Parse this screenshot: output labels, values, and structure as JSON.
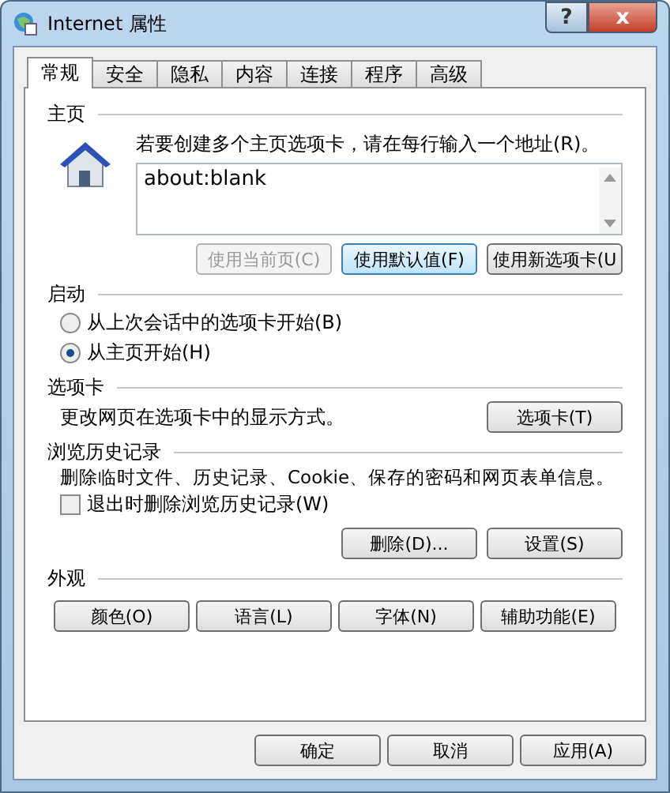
{
  "window": {
    "title": "Internet 属性",
    "help_button": "?",
    "close_button": "x"
  },
  "tabs": [
    {
      "label": "常规",
      "selected": true
    },
    {
      "label": "安全",
      "selected": false
    },
    {
      "label": "隐私",
      "selected": false
    },
    {
      "label": "内容",
      "selected": false
    },
    {
      "label": "连接",
      "selected": false
    },
    {
      "label": "程序",
      "selected": false
    },
    {
      "label": "高级",
      "selected": false
    }
  ],
  "home_page": {
    "heading": "主页",
    "instruction": "若要创建多个主页选项卡，请在每行输入一个地址(R)。",
    "value": "about:blank",
    "buttons": [
      {
        "label": "使用当前页(C)",
        "disabled": true,
        "focused": false
      },
      {
        "label": "使用默认值(F)",
        "disabled": false,
        "focused": true
      },
      {
        "label": "使用新选项卡(U",
        "disabled": false,
        "focused": false
      }
    ]
  },
  "startup": {
    "heading": "启动",
    "options": [
      {
        "label": "从上次会话中的选项卡开始(B)",
        "selected": false
      },
      {
        "label": "从主页开始(H)",
        "selected": true
      }
    ]
  },
  "tabs_section": {
    "heading": "选项卡",
    "description": "更改网页在选项卡中的显示方式。",
    "button": "选项卡(T)"
  },
  "history": {
    "heading": "浏览历史记录",
    "description": "删除临时文件、历史记录、Cookie、保存的密码和网页表单信息。",
    "checkbox": {
      "label": "退出时删除浏览历史记录(W)",
      "checked": false
    },
    "buttons": [
      "删除(D)...",
      "设置(S)"
    ]
  },
  "appearance": {
    "heading": "外观",
    "buttons": [
      "颜色(O)",
      "语言(L)",
      "字体(N)",
      "辅助功能(E)"
    ]
  },
  "footer_buttons": [
    "确定",
    "取消",
    "应用(A)"
  ]
}
